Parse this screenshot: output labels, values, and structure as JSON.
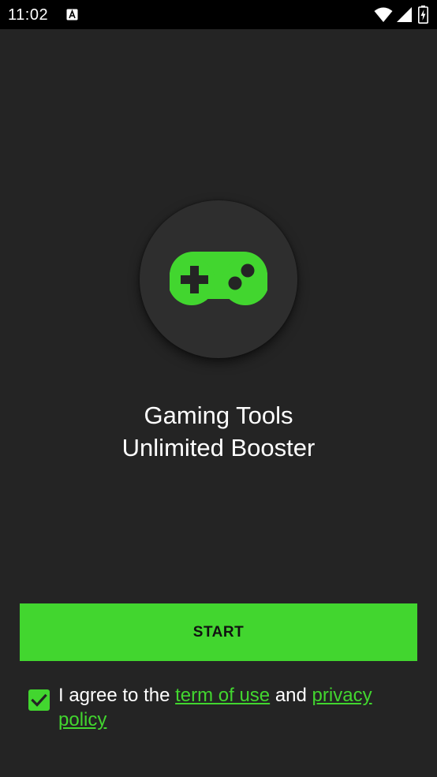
{
  "status_bar": {
    "time": "11:02",
    "notification_icon": "font-a-icon",
    "wifi_icon": "wifi-icon",
    "signal_icon": "cell-signal-icon",
    "battery_icon": "battery-charging-icon"
  },
  "logo": {
    "icon": "gamepad-icon",
    "accent_color": "#42d62f"
  },
  "title": {
    "line1": "Gaming Tools",
    "line2": "Unlimited Booster"
  },
  "start_button": {
    "label": "START",
    "color": "#42d62f"
  },
  "agreement": {
    "checked": true,
    "prefix": "I agree to the ",
    "terms_link": "term of use",
    "conjunction": " and ",
    "privacy_link": "privacy policy"
  },
  "colors": {
    "background": "#242424",
    "status_bar": "#000000",
    "accent": "#42d62f"
  }
}
